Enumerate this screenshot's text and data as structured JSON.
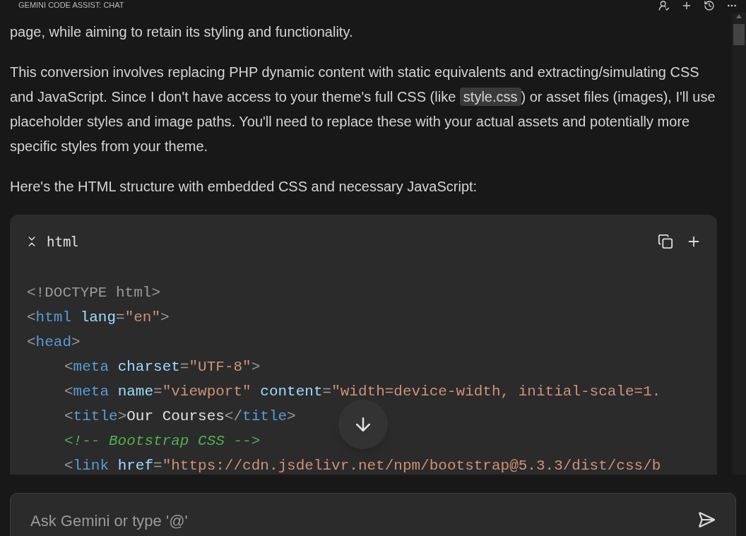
{
  "panel_title": "GEMINI CODE ASSIST: CHAT",
  "message": [
    {
      "segments": [
        {
          "kind": "text",
          "text": "page, while aiming to retain its styling and functionality."
        }
      ]
    },
    {
      "segments": [
        {
          "kind": "text",
          "text": "This conversion involves replacing PHP dynamic content with static equivalents and extracting/simulating CSS and JavaScript. Since I don't have access to your theme's full CSS (like "
        },
        {
          "kind": "code",
          "text": "style.css"
        },
        {
          "kind": "text",
          "text": ") or asset files (images), I'll use placeholder styles and image paths. You'll need to replace these with your actual assets and potentially more specific styles from your theme."
        }
      ]
    },
    {
      "segments": [
        {
          "kind": "text",
          "text": "Here's the HTML structure with embedded CSS and necessary JavaScript:"
        }
      ]
    }
  ],
  "code_block": {
    "language": "html",
    "lines": [
      {
        "tokens": [
          {
            "kind": "punct",
            "text": "<!DOCTYPE html>"
          }
        ]
      },
      {
        "tokens": [
          {
            "kind": "punct",
            "text": "<"
          },
          {
            "kind": "tag",
            "text": "html"
          },
          {
            "kind": "attr",
            "text": " lang"
          },
          {
            "kind": "punct",
            "text": "="
          },
          {
            "kind": "string",
            "text": "\"en\""
          },
          {
            "kind": "punct",
            "text": ">"
          }
        ]
      },
      {
        "tokens": [
          {
            "kind": "punct",
            "text": "<"
          },
          {
            "kind": "tag",
            "text": "head"
          },
          {
            "kind": "punct",
            "text": ">"
          }
        ],
        "children": [
          {
            "tokens": [
              {
                "kind": "punct",
                "text": "<"
              },
              {
                "kind": "tag",
                "text": "meta"
              },
              {
                "kind": "attr",
                "text": " charset"
              },
              {
                "kind": "punct",
                "text": "="
              },
              {
                "kind": "string",
                "text": "\"UTF-8\""
              },
              {
                "kind": "punct",
                "text": ">"
              }
            ]
          },
          {
            "tokens": [
              {
                "kind": "punct",
                "text": "<"
              },
              {
                "kind": "tag",
                "text": "meta"
              },
              {
                "kind": "attr",
                "text": " name"
              },
              {
                "kind": "punct",
                "text": "="
              },
              {
                "kind": "string",
                "text": "\"viewport\""
              },
              {
                "kind": "attr",
                "text": " content"
              },
              {
                "kind": "punct",
                "text": "="
              },
              {
                "kind": "string",
                "text": "\"width=device-width, initial-scale=1."
              }
            ]
          },
          {
            "tokens": [
              {
                "kind": "punct",
                "text": "<"
              },
              {
                "kind": "tag",
                "text": "title"
              },
              {
                "kind": "punct",
                "text": ">"
              },
              {
                "kind": "text",
                "text": "Our Courses"
              },
              {
                "kind": "punct",
                "text": "</"
              },
              {
                "kind": "tag",
                "text": "title"
              },
              {
                "kind": "punct",
                "text": ">"
              }
            ]
          },
          {
            "tokens": [
              {
                "kind": "comment",
                "text": "<!-- Bootstrap CSS -->"
              }
            ]
          },
          {
            "tokens": [
              {
                "kind": "punct",
                "text": "<"
              },
              {
                "kind": "tag",
                "text": "link"
              },
              {
                "kind": "attr",
                "text": " href"
              },
              {
                "kind": "punct",
                "text": "="
              },
              {
                "kind": "string",
                "text": "\"https://cdn.jsdelivr.net/npm/bootstrap@5.3.3/dist/css/b"
              }
            ]
          }
        ]
      }
    ]
  },
  "chat_input": {
    "placeholder": "Ask Gemini or type '@'"
  }
}
